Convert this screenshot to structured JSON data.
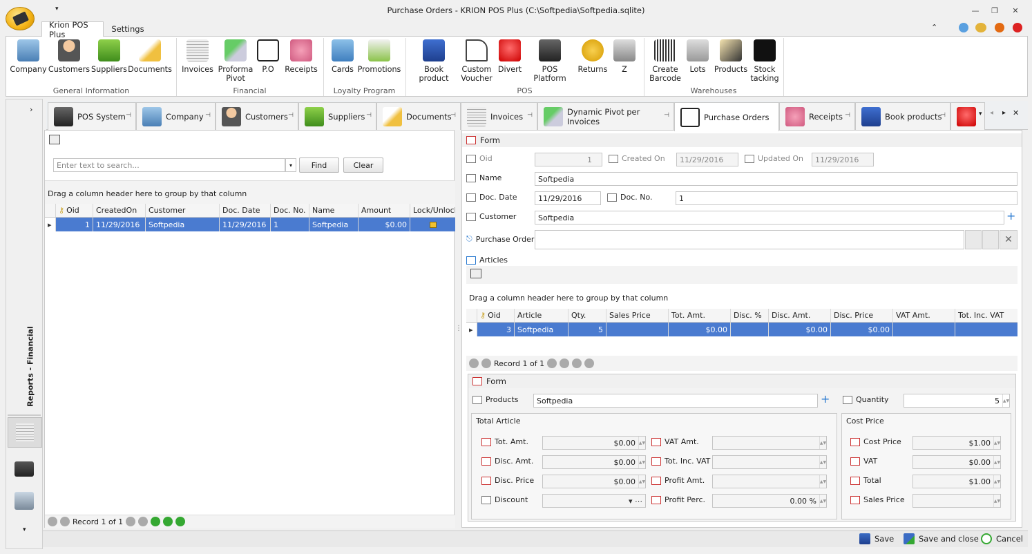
{
  "window": {
    "title": "Purchase Orders - KRION POS Plus (C:\\Softpedia\\Softpedia.sqlite)"
  },
  "ribbon_tabs": [
    "Krion POS Plus",
    "Settings"
  ],
  "ribbon": {
    "buttons": [
      "Company",
      "Customers",
      "Suppliers",
      "Documents",
      "Invoices",
      "Proforma\nPivot",
      "P.O",
      "Receipts",
      "Cards",
      "Promotions",
      "Book product",
      "Custom\nVoucher",
      "Divert",
      "POS Platform",
      "Returns",
      "Z",
      "Create\nBarcode",
      "Lots",
      "Products",
      "Stock\ntacking"
    ],
    "groups": [
      "General Information",
      "Financial",
      "Loyalty Program",
      "POS",
      "Warehouses"
    ]
  },
  "side": {
    "vertical_label": "Reports - Financial"
  },
  "doc_tabs": [
    "POS System",
    "Company",
    "Customers",
    "Suppliers",
    "Documents",
    "Invoices",
    "Dynamic Pivot per Invoices",
    "Purchase Orders",
    "Receipts",
    "Book products"
  ],
  "left": {
    "search_placeholder": "Enter text to search...",
    "find": "Find",
    "clear": "Clear",
    "group_hint": "Drag a column header here to group by that column",
    "columns": [
      "Oid",
      "CreatedOn",
      "Customer",
      "Doc. Date",
      "Doc. No.",
      "Name",
      "Amount",
      "Lock/Unlock"
    ],
    "row": [
      "1",
      "11/29/2016",
      "Softpedia",
      "11/29/2016",
      "1",
      "Softpedia",
      "$0.00",
      ""
    ],
    "nav": "Record 1 of 1"
  },
  "form": {
    "title": "Form",
    "oid_label": "Oid",
    "oid": "1",
    "created_label": "Created On",
    "created": "11/29/2016",
    "updated_label": "Updated On",
    "updated": "11/29/2016",
    "name_label": "Name",
    "name": "Softpedia",
    "docdate_label": "Doc. Date",
    "docdate": "11/29/2016",
    "docno_label": "Doc. No.",
    "docno": "1",
    "customer_label": "Customer",
    "customer": "Softpedia",
    "po_label": "Purchase Order",
    "articles_label": "Articles",
    "group_hint": "Drag a column header here to group by that column",
    "art_columns": [
      "Oid",
      "Article",
      "Qty.",
      "Sales Price",
      "Tot. Amt.",
      "Disc. %",
      "Disc. Amt.",
      "Disc. Price",
      "VAT Amt.",
      "Tot. Inc. VAT"
    ],
    "art_row": [
      "3",
      "Softpedia",
      "5",
      "",
      "$0.00",
      "",
      "$0.00",
      "$0.00",
      "",
      ""
    ],
    "art_nav": "Record 1 of 1"
  },
  "subform": {
    "title": "Form",
    "products_label": "Products",
    "products": "Softpedia",
    "quantity_label": "Quantity",
    "quantity": "5",
    "total_article": "Total Article",
    "cost_price_group": "Cost Price",
    "tot_amt_label": "Tot. Amt.",
    "tot_amt": "$0.00",
    "disc_amt_label": "Disc. Amt.",
    "disc_amt": "$0.00",
    "disc_price_label": "Disc. Price",
    "disc_price": "$0.00",
    "discount_label": "Discount",
    "vat_amt_label": "VAT Amt.",
    "tot_inc_vat_label": "Tot. Inc. VAT",
    "profit_amt_label": "Profit Amt.",
    "profit_perc_label": "Profit Perc.",
    "profit_perc": "0.00 %",
    "cost_price_label": "Cost Price",
    "cost_price": "$1.00",
    "vat_label": "VAT",
    "vat": "$0.00",
    "total_label": "Total",
    "total": "$1.00",
    "sales_price_label": "Sales Price"
  },
  "bottom": {
    "save": "Save",
    "save_close": "Save and close",
    "cancel": "Cancel"
  },
  "colors": {
    "selection": "#4a7bd0",
    "accent": "#f4b315"
  }
}
